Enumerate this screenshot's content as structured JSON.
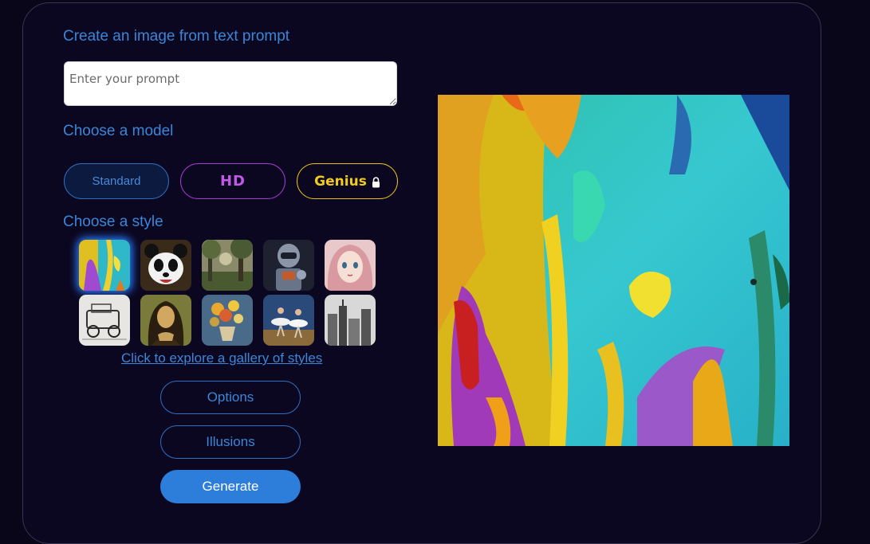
{
  "headings": {
    "create": "Create an image from text prompt",
    "model": "Choose a model",
    "style": "Choose a style"
  },
  "prompt": {
    "placeholder": "Enter your prompt",
    "value": ""
  },
  "models": {
    "standard": "Standard",
    "hd": "HD",
    "genius": "Genius",
    "genius_locked_icon": "lock-icon",
    "selected": "Standard"
  },
  "styles": {
    "thumbnails": [
      "abstract-painting-thumbnail",
      "panda-thumbnail",
      "forest-landscape-thumbnail",
      "robot-thumbnail",
      "anime-girl-thumbnail",
      "vintage-car-sketch-thumbnail",
      "mona-lisa-thumbnail",
      "flower-vase-thumbnail",
      "ballet-dancers-thumbnail",
      "city-sketch-thumbnail"
    ],
    "selected_index": 0,
    "gallery_link": "Click to explore a gallery of styles"
  },
  "buttons": {
    "options": "Options",
    "illusions": "Illusions",
    "generate": "Generate"
  },
  "colors": {
    "background": "#0a0619",
    "accent": "#3a86d8",
    "hd": "#c257e8",
    "genius": "#f2cc1a",
    "generate": "#2d7ddb"
  }
}
